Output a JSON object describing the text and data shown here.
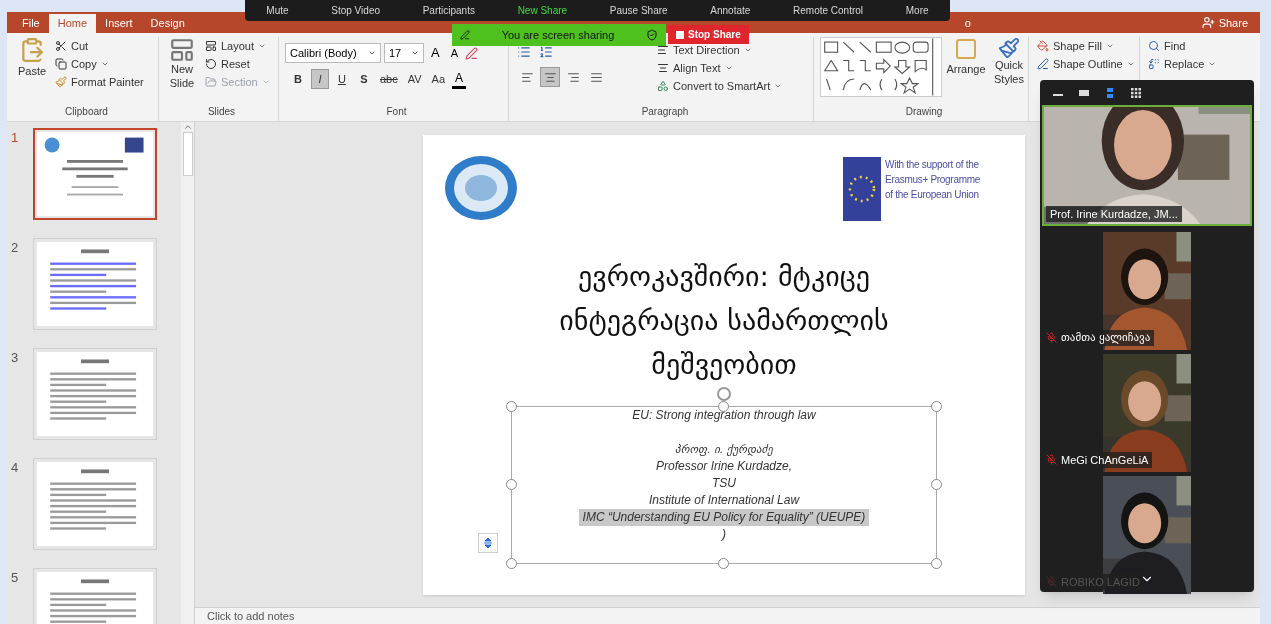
{
  "zoom_toolbar": {
    "items": [
      {
        "label": "Mute",
        "kind": "normal"
      },
      {
        "label": "Stop Video",
        "kind": "normal"
      },
      {
        "label": "Participants",
        "kind": "normal"
      },
      {
        "label": "New Share",
        "kind": "highlight"
      },
      {
        "label": "Pause Share",
        "kind": "normal"
      },
      {
        "label": "Annotate",
        "kind": "normal"
      },
      {
        "label": "Remote Control",
        "kind": "normal"
      },
      {
        "label": "More",
        "kind": "normal"
      }
    ]
  },
  "share_banner": {
    "message": "You are screen sharing",
    "stop_label": "Stop Share"
  },
  "ribbon": {
    "tabs": [
      {
        "label": "File",
        "selected": false
      },
      {
        "label": "Home",
        "selected": true
      },
      {
        "label": "Insert",
        "selected": false
      },
      {
        "label": "Design",
        "selected": false
      },
      {
        "label": "o",
        "selected": false
      }
    ],
    "share": "Share",
    "clipboard": {
      "title": "Clipboard",
      "paste": "Paste",
      "cut": "Cut",
      "copy": "Copy",
      "format_painter": "Format Painter"
    },
    "slides": {
      "title": "Slides",
      "new_slide": "New Slide",
      "layout": "Layout",
      "reset": "Reset",
      "section": {
        "label": "Section",
        "disabled": true
      }
    },
    "font": {
      "title": "Font",
      "family": "Calibri (Body)",
      "size": "17",
      "grow": "A",
      "shrink": "A",
      "font_color_label": "A",
      "styles": [
        {
          "label": "B",
          "selected": false
        },
        {
          "label": "I",
          "selected": true
        },
        {
          "label": "U",
          "selected": false
        },
        {
          "label": "S",
          "selected": false
        },
        {
          "label": "abc",
          "selected": false
        },
        {
          "label": "AV",
          "selected": false
        },
        {
          "label": "Aa",
          "selected": false
        }
      ]
    },
    "paragraph": {
      "title": "Paragraph",
      "text_direction": "Text Direction",
      "align_text": "Align Text",
      "smartart": "Convert to SmartArt",
      "align": [
        {
          "selected": false
        },
        {
          "selected": true
        },
        {
          "selected": false
        },
        {
          "selected": false
        }
      ]
    },
    "drawing": {
      "title": "Drawing",
      "arrange": "Arrange",
      "quick_styles": "Quick Styles",
      "shape_fill": "Shape Fill",
      "shape_outline": "Shape Outline"
    },
    "editing": {
      "find": "Find",
      "replace": "Replace"
    }
  },
  "thumbnails": [
    {
      "number": "1",
      "selected": true,
      "kind": "title"
    },
    {
      "number": "2",
      "selected": false,
      "kind": "links"
    },
    {
      "number": "3",
      "selected": false,
      "kind": "text"
    },
    {
      "number": "4",
      "selected": false,
      "kind": "text"
    },
    {
      "number": "5",
      "selected": false,
      "kind": "text"
    }
  ],
  "slide": {
    "logo_caption": [
      "With the support of the",
      "Erasmus+ Programme",
      "of the European Union"
    ],
    "title_lines": [
      "ევროკავშირი: მტკიცე",
      "ინტეგრაცია სამართლის",
      "მეშვეობით"
    ],
    "subtitle_lines": [
      {
        "text": "EU: Strong integration through law",
        "highlighted": false
      },
      {
        "text": "პროფ. ი. ქურდაძე",
        "highlighted": false
      },
      {
        "text": "Professor Irine Kurdadze,",
        "highlighted": false
      },
      {
        "text": "TSU",
        "highlighted": false
      },
      {
        "text": "Institute of International Law",
        "highlighted": false
      },
      {
        "text": "IMC “Understanding EU Policy for Equality” (UEUPE)",
        "highlighted": true
      },
      {
        "text": ")",
        "highlighted": false
      }
    ]
  },
  "notes": {
    "placeholder": "Click to add notes"
  },
  "gallery": {
    "view_buttons": [
      {
        "selected": false
      },
      {
        "selected": false
      },
      {
        "selected": true
      },
      {
        "selected": false
      }
    ],
    "participants": [
      {
        "name": "Prof. Irine Kurdadze, JM...",
        "muted": false,
        "active_speaker": true,
        "faded": false
      },
      {
        "name": "თამთა ყალიჩავა",
        "muted": true,
        "active_speaker": false,
        "faded": false
      },
      {
        "name": "MeGi ChAnGeLiA",
        "muted": true,
        "active_speaker": false,
        "faded": false
      },
      {
        "name": "ROBIKO LAGID",
        "muted": true,
        "active_speaker": false,
        "faded": true
      }
    ]
  }
}
